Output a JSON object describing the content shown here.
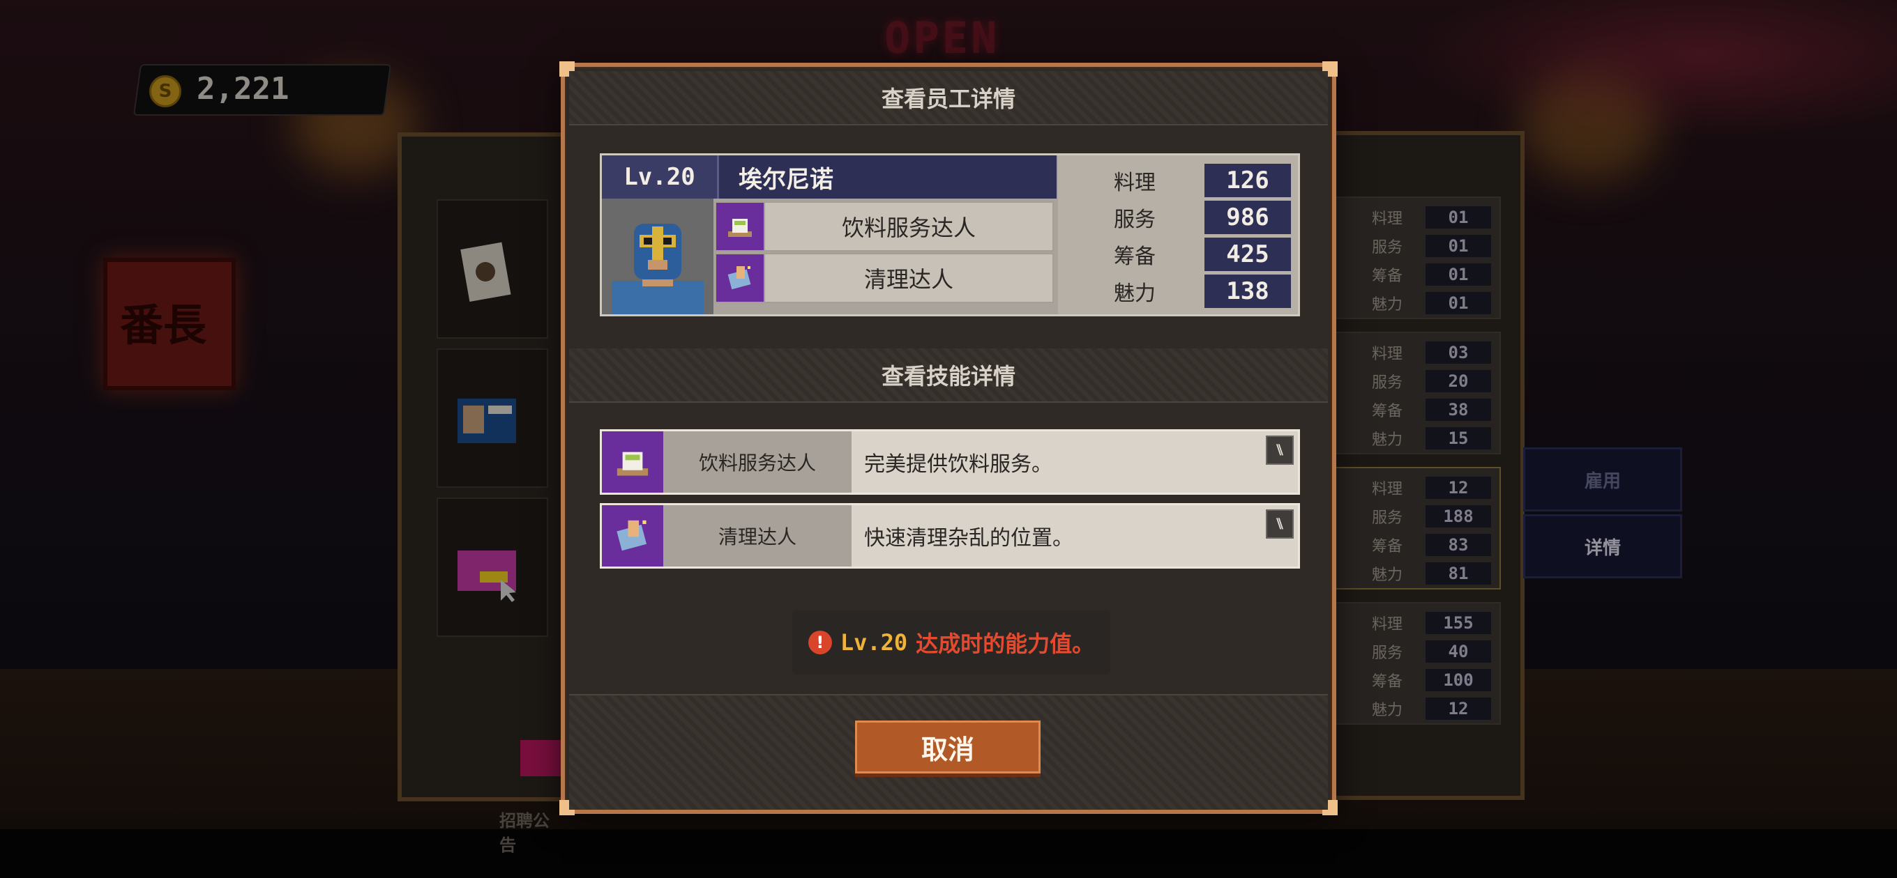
{
  "hud": {
    "coins": "2,221",
    "coin_symbol": "S"
  },
  "background": {
    "neon_sign": "OPEN",
    "left_sign_chars": "番長",
    "recruit_label": "招聘公告"
  },
  "right_panel": {
    "candidates": [
      {
        "stats": [
          {
            "k": "料理",
            "v": "01"
          },
          {
            "k": "服务",
            "v": "01"
          },
          {
            "k": "筹备",
            "v": "01"
          },
          {
            "k": "魅力",
            "v": "01"
          }
        ]
      },
      {
        "stats": [
          {
            "k": "料理",
            "v": "03"
          },
          {
            "k": "服务",
            "v": "20"
          },
          {
            "k": "筹备",
            "v": "38"
          },
          {
            "k": "魅力",
            "v": "15"
          }
        ]
      },
      {
        "stats": [
          {
            "k": "料理",
            "v": "12"
          },
          {
            "k": "服务",
            "v": "188"
          },
          {
            "k": "筹备",
            "v": "83"
          },
          {
            "k": "魅力",
            "v": "81"
          }
        ]
      },
      {
        "stats": [
          {
            "k": "料理",
            "v": "155"
          },
          {
            "k": "服务",
            "v": "40"
          },
          {
            "k": "筹备",
            "v": "100"
          },
          {
            "k": "魅力",
            "v": "12"
          }
        ]
      }
    ],
    "hire_label": "雇用",
    "details_label": "详情"
  },
  "dialog": {
    "title": "查看员工详情",
    "employee": {
      "level": "Lv.20",
      "name": "埃尔尼诺",
      "traits": [
        "饮料服务达人",
        "清理达人"
      ],
      "stats": [
        {
          "k": "料理",
          "v": "126"
        },
        {
          "k": "服务",
          "v": "986"
        },
        {
          "k": "筹备",
          "v": "425"
        },
        {
          "k": "魅力",
          "v": "138"
        }
      ]
    },
    "skills_title": "查看技能详情",
    "skills": [
      {
        "name": "饮料服务达人",
        "desc": "完美提供饮料服务。",
        "icon": "tea-cup-icon"
      },
      {
        "name": "清理达人",
        "desc": "快速清理杂乱的位置。",
        "icon": "cleaning-cloth-icon"
      }
    ],
    "notice": {
      "level": "Lv.20",
      "text": "达成时的能力值。"
    },
    "cancel_label": "取消"
  }
}
